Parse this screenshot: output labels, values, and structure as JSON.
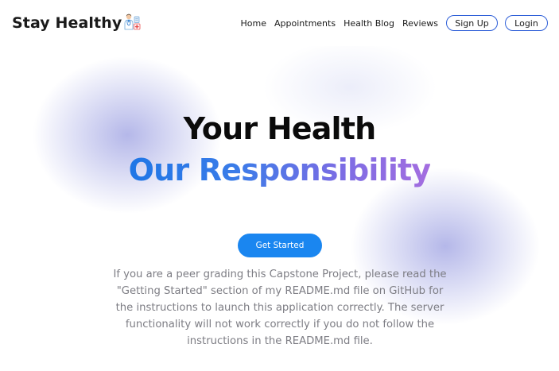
{
  "brand": {
    "name": "Stay Healthy",
    "icon": "doctor-icon"
  },
  "nav": {
    "links": [
      "Home",
      "Appointments",
      "Health Blog",
      "Reviews"
    ],
    "signup_label": "Sign Up",
    "login_label": "Login"
  },
  "hero": {
    "title_line1": "Your Health",
    "title_line2": "Our Responsibility",
    "cta_label": "Get Started",
    "description": "If you are a peer grading this Capstone Project, please read the \"Getting Started\" section of my README.md file on GitHub for the instructions to launch this application correctly. The server functionality will not work correctly if you do not follow the instructions in the README.md file."
  },
  "colors": {
    "accent": "#1a86f0",
    "outline_button_border": "#2e5fd8",
    "gradient_start": "#1f76e6",
    "gradient_end": "#a46de0",
    "blob": "#8c90d8",
    "description_text": "#7d7d84"
  }
}
